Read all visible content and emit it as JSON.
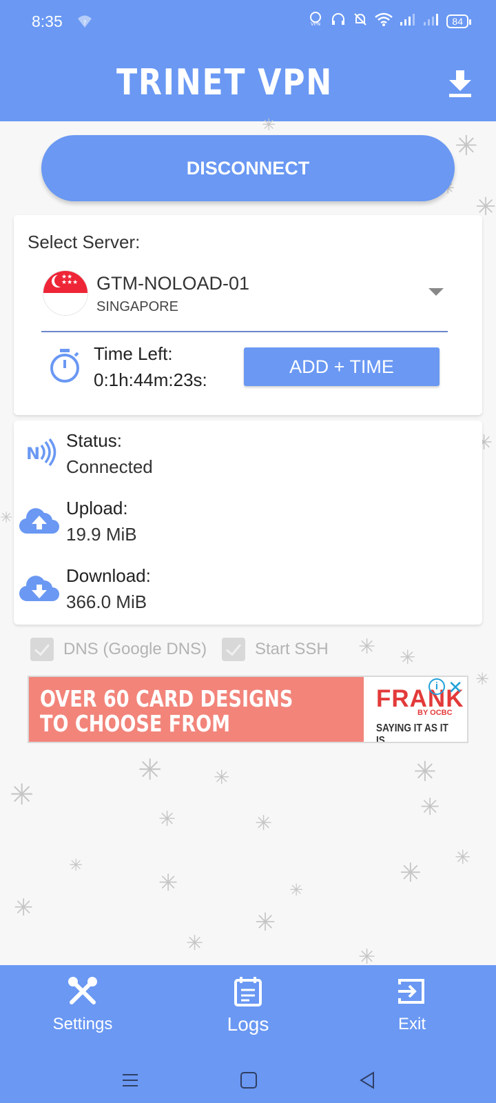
{
  "status_bar": {
    "time": "8:35",
    "battery": "84"
  },
  "app": {
    "title": "TRINET VPN",
    "accent_color": "#6a98f3"
  },
  "main": {
    "disconnect_label": "DISCONNECT",
    "select_server_label": "Select Server:",
    "server": {
      "name": "GTM-NOLOAD-01",
      "country": "SINGAPORE",
      "flag_icon": "singapore-flag-icon"
    },
    "time_left_label": "Time Left:",
    "time_left_value": "0:1h:44m:23s:",
    "add_time_label": "ADD + TIME"
  },
  "stats": [
    {
      "label": "Status:",
      "value": "Connected",
      "icon": "signal-waves-icon"
    },
    {
      "label": "Upload:",
      "value": "19.9 MiB",
      "icon": "cloud-upload-icon"
    },
    {
      "label": "Download:",
      "value": "366.0 MiB",
      "icon": "cloud-download-icon"
    }
  ],
  "options": {
    "dns_label": "DNS (Google DNS)",
    "ssh_label": "Start SSH"
  },
  "ad": {
    "headline_line1": "OVER 60 CARD DESIGNS",
    "headline_line2": "TO CHOOSE FROM",
    "brand": "FRANK",
    "brand_sub": "BY OCBC",
    "tagline": "SAYING IT AS IT IS."
  },
  "bottom_nav": {
    "settings_label": "Settings",
    "logs_label": "Logs",
    "exit_label": "Exit"
  }
}
